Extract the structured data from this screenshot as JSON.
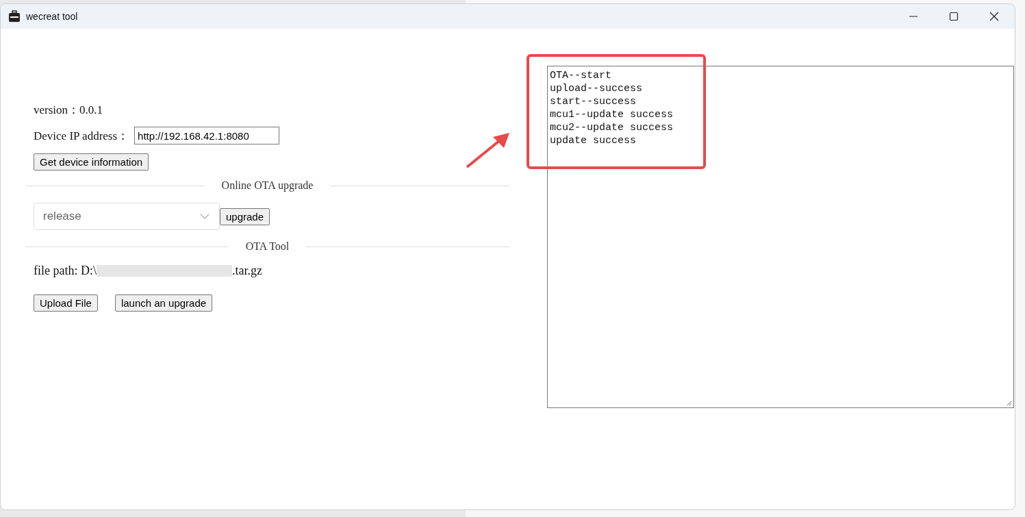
{
  "window": {
    "title": "wecreat tool"
  },
  "version": {
    "label": "version：",
    "value": "0.0.1"
  },
  "device_ip": {
    "label": "Device IP address：",
    "value": "http://192.168.42.1:8080"
  },
  "get_info_button": "Get device information",
  "online_section": {
    "title": "Online OTA upgrade",
    "select_value": "release",
    "button": "upgrade"
  },
  "ota_tool": {
    "title": "OTA Tool",
    "file_path_label": "file path: D:\\",
    "file_path_end": ".tar.gz",
    "buttons": [
      "Upload File",
      "launch an upgrade"
    ]
  },
  "log": {
    "lines": [
      "OTA--start",
      "upload--success",
      "start--success",
      "mcu1--update success",
      "mcu2--update success",
      "update success"
    ]
  }
}
